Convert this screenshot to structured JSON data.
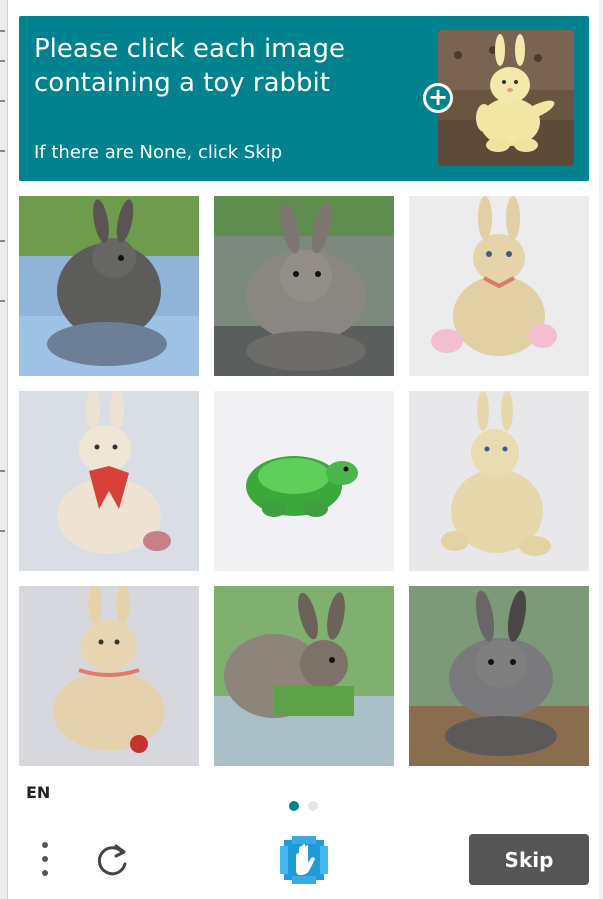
{
  "challenge": {
    "prompt": "Please click each image containing a toy rabbit",
    "subprompt": "If there are None, click Skip",
    "accent_color": "#00838f"
  },
  "grid": {
    "tiles": [
      {
        "subject": "real gray rabbit by water"
      },
      {
        "subject": "real gray rabbit with reflection"
      },
      {
        "subject": "plush toy rabbit with pink feet"
      },
      {
        "subject": "plush toy rabbit with red scarf"
      },
      {
        "subject": "green toy turtle"
      },
      {
        "subject": "plush toy rabbit sitting"
      },
      {
        "subject": "plush toy rabbit with red ribbon"
      },
      {
        "subject": "real rabbit in grass by water"
      },
      {
        "subject": "real gray rabbit reflection in water"
      }
    ]
  },
  "footer": {
    "language": "EN",
    "skip_label": "Skip",
    "menu_icon": "vertical-dots-icon",
    "refresh_icon": "refresh-icon",
    "logo_icon": "hcaptcha-hand-logo"
  },
  "pagination": {
    "active_color": "#00838f",
    "inactive_color": "#e4e4e4"
  }
}
